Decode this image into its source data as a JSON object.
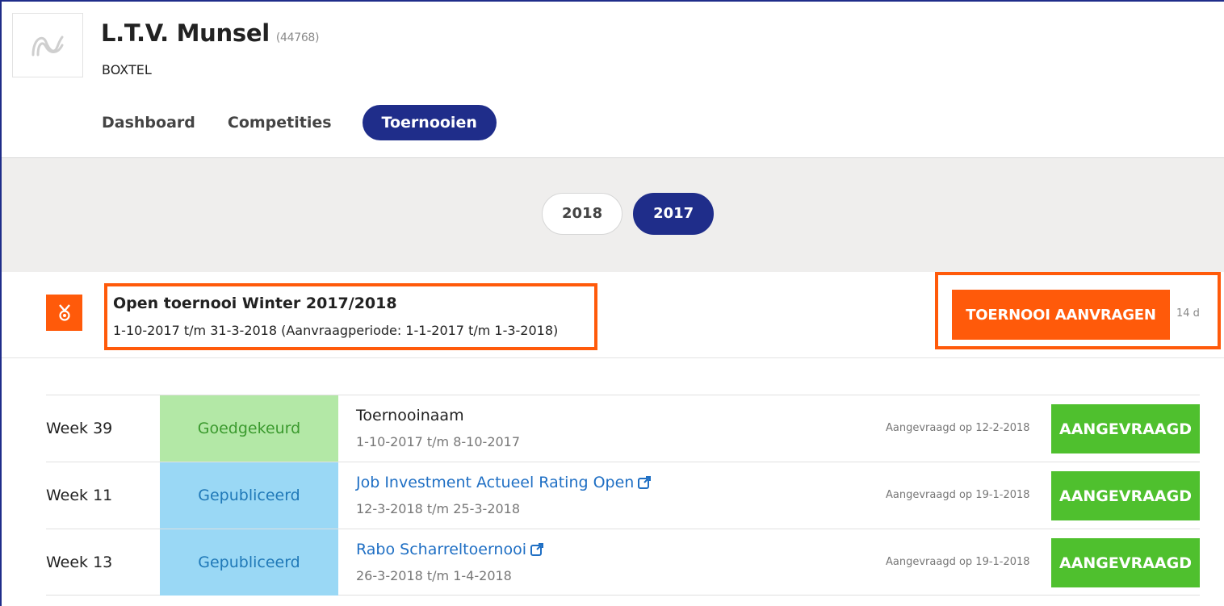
{
  "club": {
    "name": "L.T.V. Munsel",
    "id": "(44768)",
    "city": "BOXTEL",
    "logo_icon": "wave-logo-icon"
  },
  "nav": {
    "items": [
      {
        "label": "Dashboard",
        "active": false
      },
      {
        "label": "Competities",
        "active": false
      },
      {
        "label": "Toernooien",
        "active": true
      }
    ]
  },
  "years": {
    "items": [
      {
        "label": "2018",
        "active": false
      },
      {
        "label": "2017",
        "active": true
      }
    ]
  },
  "tournament": {
    "icon": "medal-icon",
    "title": "Open toernooi Winter 2017/2018",
    "dates": "1-10-2017 t/m 31-3-2018 (Aanvraagperiode: 1-1-2017 t/m 1-3-2018)",
    "request_button": "TOERNOOI AANVRAGEN",
    "days_left": "14 d",
    "accent_color": "#ff5a0a"
  },
  "rows": [
    {
      "week": "Week 39",
      "status": "Goedgekeurd",
      "name": "Toernooinaam",
      "dates": "1-10-2017 t/m 8-10-2017",
      "requested": "Aangevraagd op 12-2-2018",
      "button": "AANGEVRAAGD"
    },
    {
      "week": "Week 11",
      "status": "Gepubliceerd",
      "name": "Job Investment Actueel Rating Open",
      "dates": "12-3-2018 t/m 25-3-2018",
      "requested": "Aangevraagd op 19-1-2018",
      "button": "AANGEVRAAGD"
    },
    {
      "week": "Week 13",
      "status": "Gepubliceerd",
      "name": "Rabo Scharreltoernooi",
      "dates": "26-3-2018 t/m 1-4-2018",
      "requested": "Aangevraagd op 19-1-2018",
      "button": "AANGEVRAAGD"
    }
  ],
  "colors": {
    "brand": "#1f2d8a",
    "approved_bg": "#b3e8a6",
    "published_bg": "#9ad8f5",
    "requested_button": "#4fc02e"
  }
}
